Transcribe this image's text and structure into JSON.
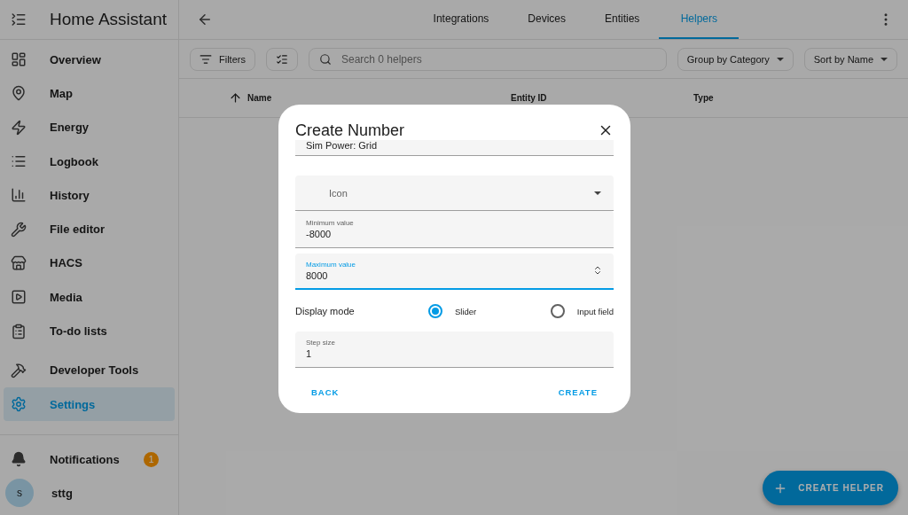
{
  "sidebar": {
    "title": "Home Assistant",
    "items": [
      {
        "label": "Overview",
        "selected": false
      },
      {
        "label": "Map",
        "selected": false
      },
      {
        "label": "Energy",
        "selected": false
      },
      {
        "label": "Logbook",
        "selected": false
      },
      {
        "label": "History",
        "selected": false
      },
      {
        "label": "File editor",
        "selected": false
      },
      {
        "label": "HACS",
        "selected": false
      },
      {
        "label": "Media",
        "selected": false
      },
      {
        "label": "To-do lists",
        "selected": false
      },
      {
        "label": "Developer Tools",
        "selected": false
      },
      {
        "label": "Settings",
        "selected": true
      }
    ],
    "notifications": {
      "label": "Notifications",
      "badge": "1"
    },
    "user": {
      "initial": "s",
      "name": "sttg"
    }
  },
  "tabs": [
    {
      "label": "Integrations",
      "selected": false
    },
    {
      "label": "Devices",
      "selected": false
    },
    {
      "label": "Entities",
      "selected": false
    },
    {
      "label": "Helpers",
      "selected": true
    }
  ],
  "toolbar": {
    "filters": "Filters",
    "search_placeholder": "Search 0 helpers",
    "group": "Group by Category",
    "sort": "Sort by Name"
  },
  "table": {
    "columns": [
      {
        "label": "Name",
        "sorted": true
      },
      {
        "label": "Entity ID",
        "sorted": false
      },
      {
        "label": "Type",
        "sorted": false
      }
    ]
  },
  "dialog": {
    "title": "Create Number",
    "fields": [
      {
        "kind": "text",
        "value": "Sim Power: Grid"
      },
      {
        "kind": "select",
        "placeholder": "Icon"
      },
      {
        "kind": "number",
        "label": "Minimum value",
        "value": "-8000",
        "focused": false
      },
      {
        "kind": "number",
        "label": "Maximum value",
        "value": "8000",
        "focused": true
      },
      {
        "kind": "radio",
        "label": "Display mode",
        "options": [
          {
            "label": "Slider",
            "selected": true
          },
          {
            "label": "Input field",
            "selected": false
          }
        ]
      },
      {
        "kind": "number",
        "label": "Step size",
        "value": "1",
        "focused": false
      }
    ],
    "buttons": [
      "BACK",
      "CREATE"
    ]
  },
  "fab": {
    "label": "CREATE HELPER"
  }
}
